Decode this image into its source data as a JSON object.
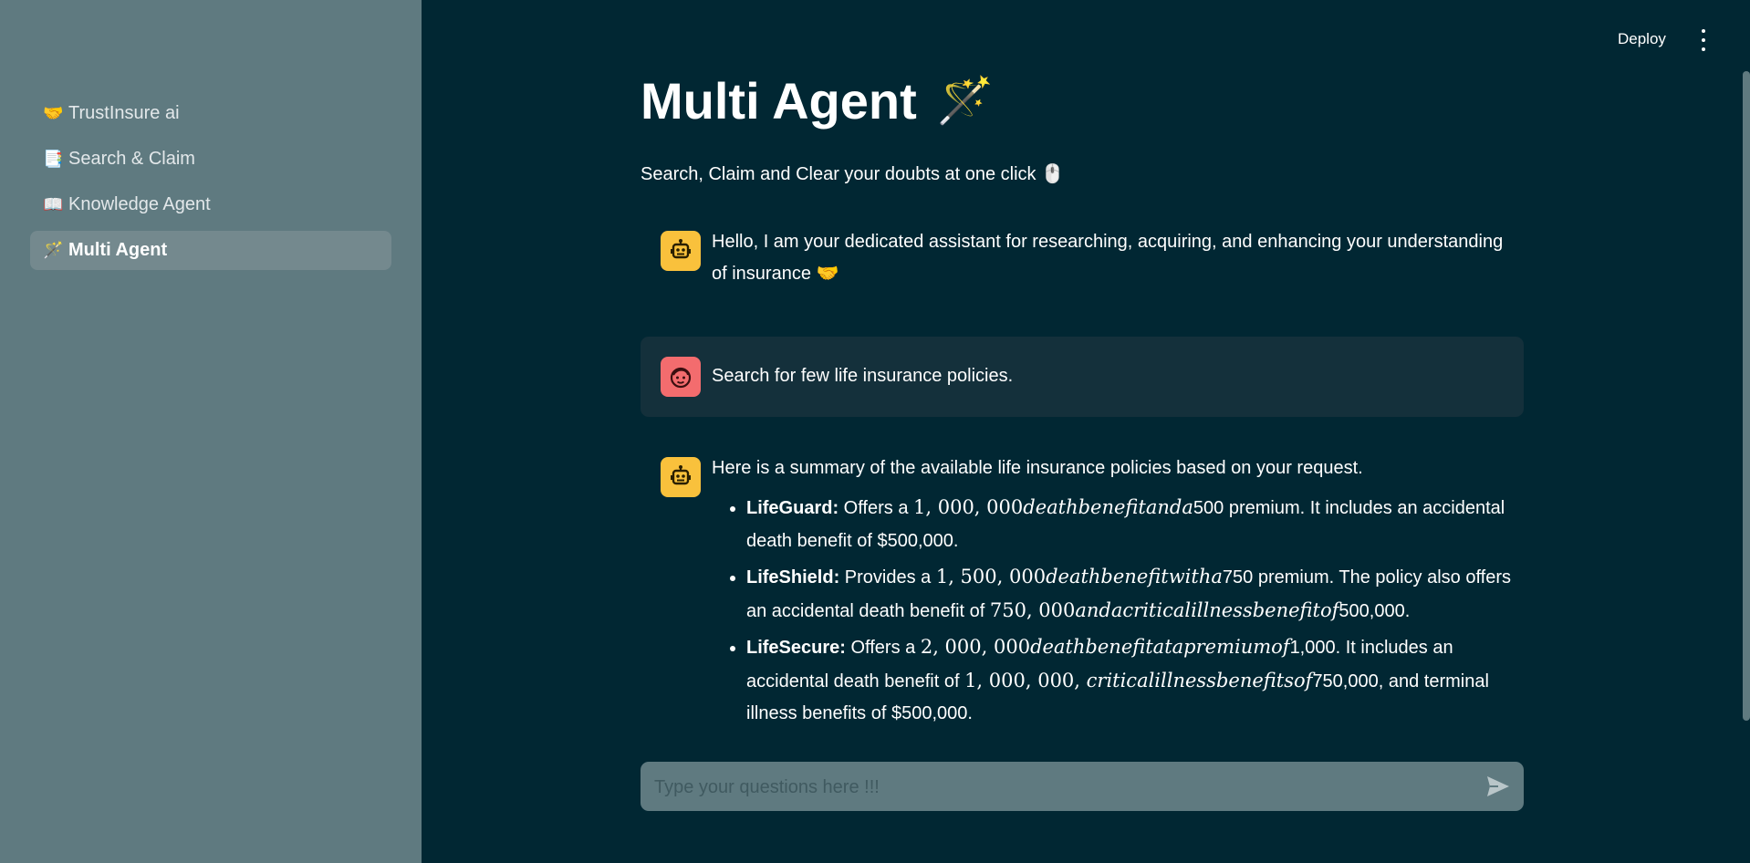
{
  "sidebar": {
    "items": [
      {
        "emoji": "🤝",
        "label": "TrustInsure ai",
        "active": false
      },
      {
        "emoji": "📑",
        "label": "Search & Claim",
        "active": false
      },
      {
        "emoji": "📖",
        "label": "Knowledge Agent",
        "active": false
      },
      {
        "emoji": "🪄",
        "label": "Multi Agent",
        "active": true
      }
    ]
  },
  "header": {
    "deploy_label": "Deploy"
  },
  "main": {
    "title": "Multi Agent",
    "title_emoji": "🪄",
    "subtitle": "Search, Claim and Clear your doubts at one click",
    "subtitle_emoji": "🖱️"
  },
  "messages": {
    "greeting": {
      "role": "assistant",
      "text": "Hello, I am your dedicated assistant for researching, acquiring, and enhancing your understanding of insurance",
      "emoji": "🤝"
    },
    "user_query": {
      "role": "user",
      "text": "Search for few life insurance policies."
    },
    "summary": {
      "role": "assistant",
      "intro": "Here is a summary of the available life insurance policies based on your request.",
      "policies": [
        {
          "name": "LifeGuard:",
          "t1": " Offers a ",
          "m1n": "1, 000, 000",
          "m1t": "deathbenefitanda",
          "t2": "500 premium. It includes an accidental death benefit of $500,000.",
          "m2n": "",
          "m2t": "",
          "t3": ""
        },
        {
          "name": "LifeShield:",
          "t1": " Provides a ",
          "m1n": "1, 500, 000",
          "m1t": "deathbenefitwitha",
          "t2": "750 premium. The policy also offers an accidental death benefit of ",
          "m2n": "750, 000",
          "m2t": "andacriticalillnessbenefitof",
          "t3": "500,000."
        },
        {
          "name": "LifeSecure:",
          "t1": " Offers a ",
          "m1n": "2, 000, 000",
          "m1t": "deathbenefitatapremiumof",
          "t2": "1,000. It includes an accidental death benefit of ",
          "m2n": "1, 000, 000, ",
          "m2t": "criticalillnessbenefitsof",
          "t3": "750,000, and terminal illness benefits of $500,000."
        }
      ]
    }
  },
  "chat_input": {
    "placeholder": "Type your questions here !!!",
    "value": ""
  }
}
